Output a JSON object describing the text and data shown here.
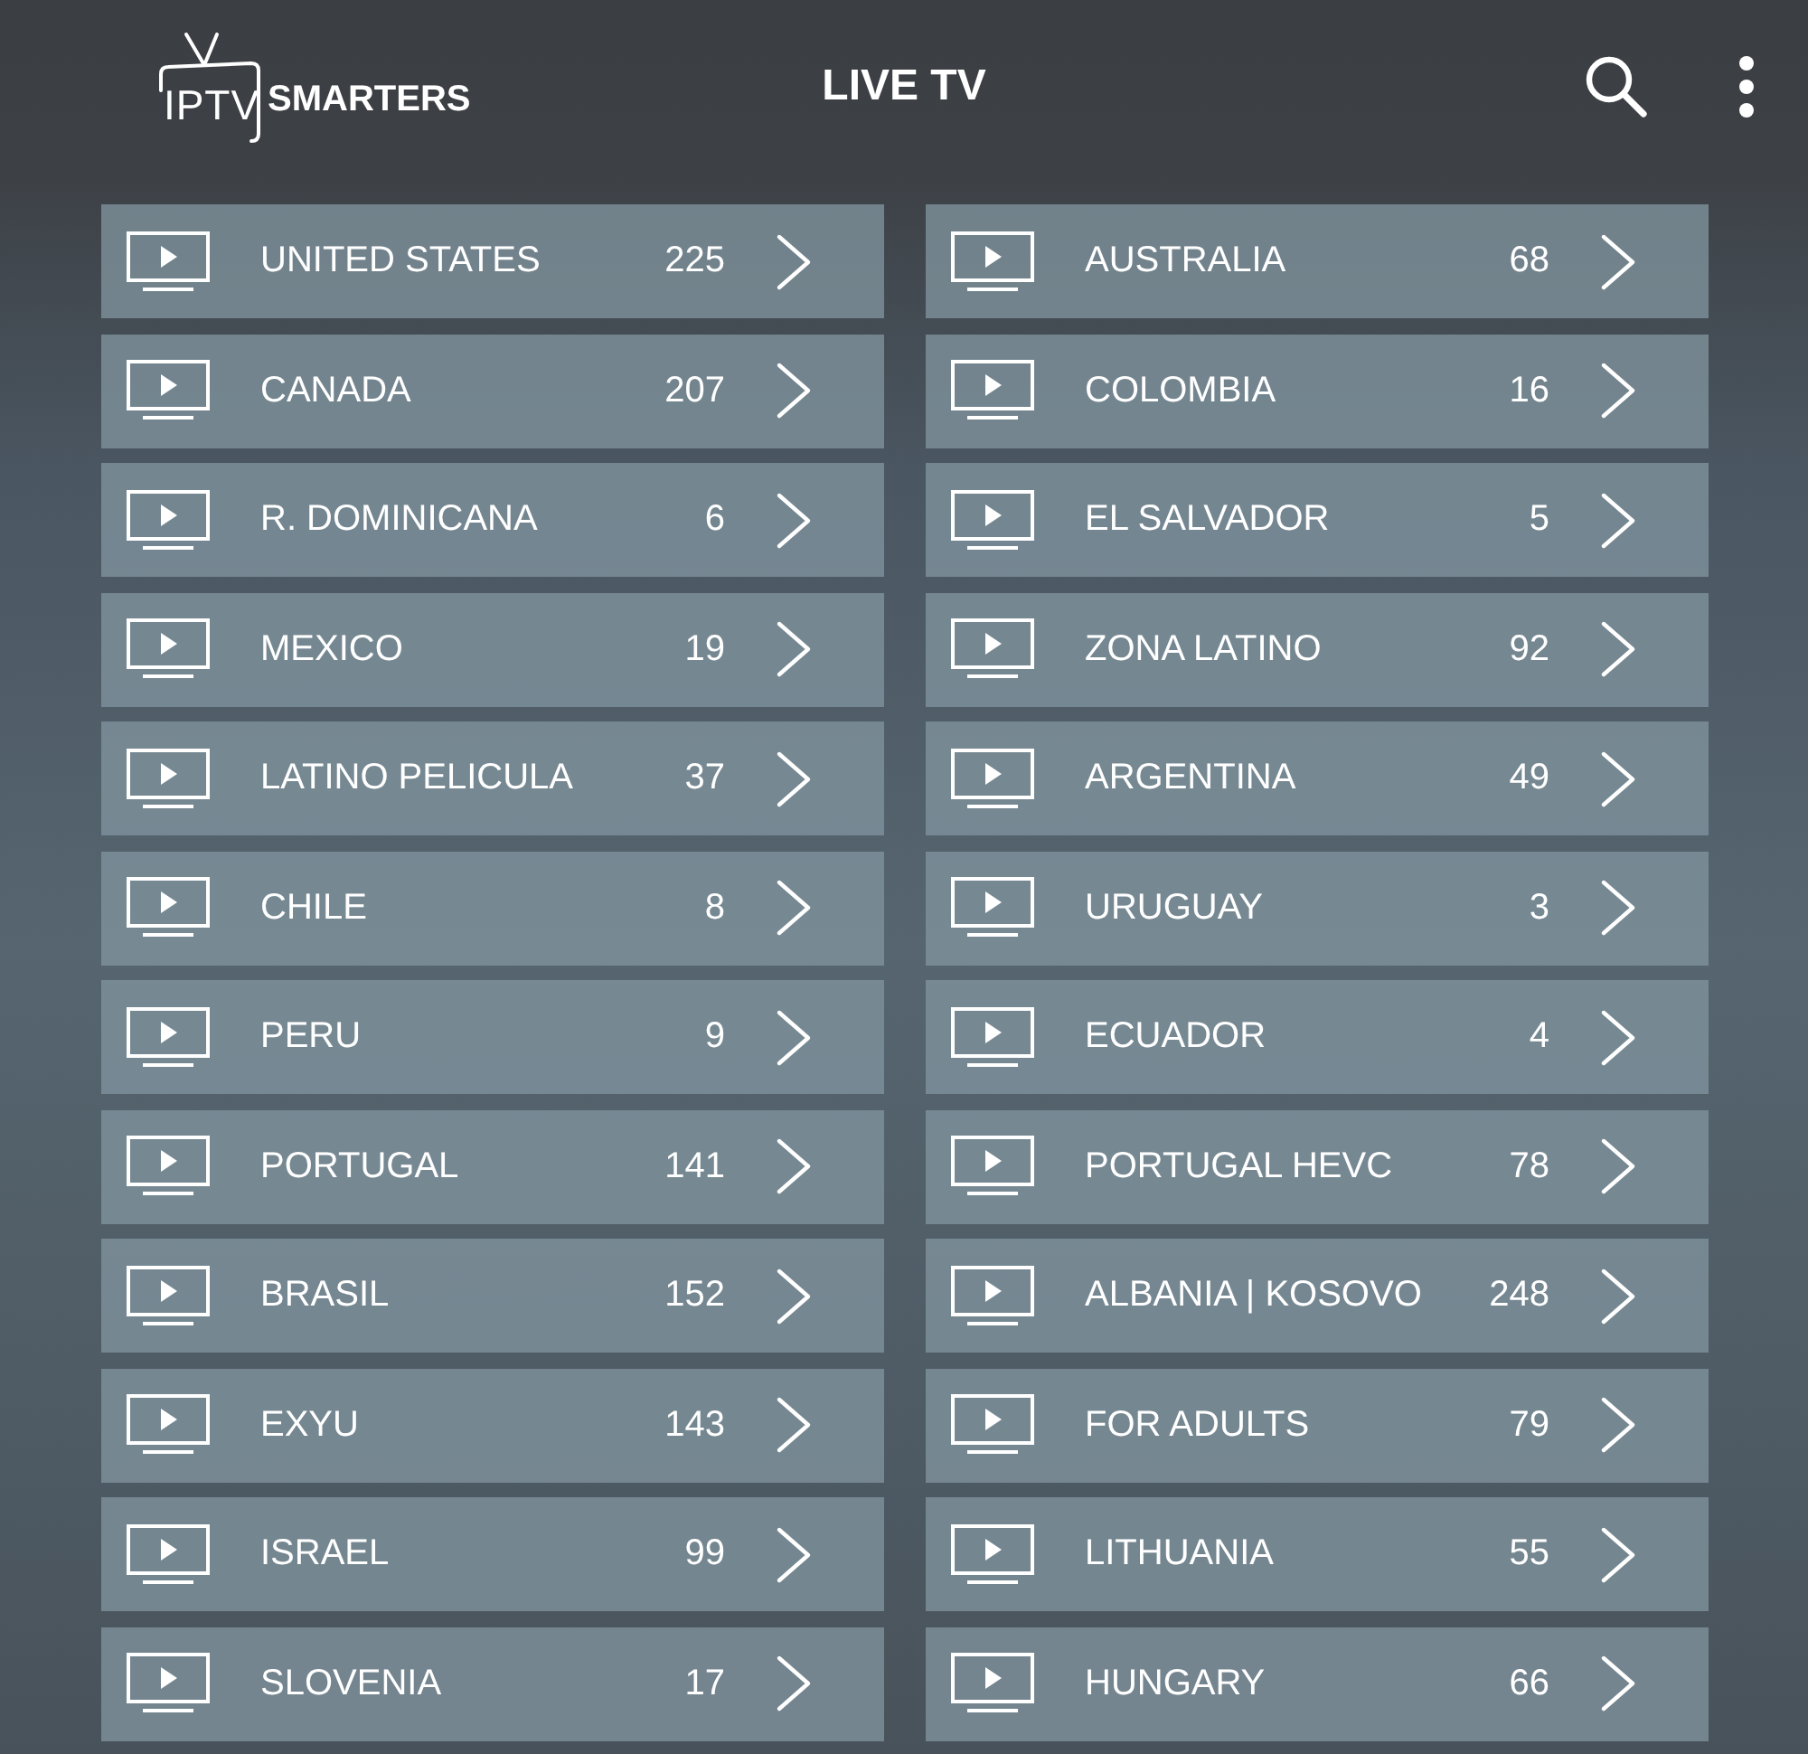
{
  "header": {
    "logo": {
      "thin_text": "IPTV",
      "bold_text": "SMARTERS"
    },
    "title": "LIVE TV"
  },
  "categories": [
    {
      "name": "UNITED STATES",
      "count": "225"
    },
    {
      "name": "AUSTRALIA",
      "count": "68"
    },
    {
      "name": "CANADA",
      "count": "207"
    },
    {
      "name": "COLOMBIA",
      "count": "16"
    },
    {
      "name": "R. DOMINICANA",
      "count": "6"
    },
    {
      "name": "EL SALVADOR",
      "count": "5"
    },
    {
      "name": "MEXICO",
      "count": "19"
    },
    {
      "name": "ZONA LATINO",
      "count": "92"
    },
    {
      "name": "LATINO PELICULA",
      "count": "37"
    },
    {
      "name": "ARGENTINA",
      "count": "49"
    },
    {
      "name": "CHILE",
      "count": "8"
    },
    {
      "name": "URUGUAY",
      "count": "3"
    },
    {
      "name": "PERU",
      "count": "9"
    },
    {
      "name": "ECUADOR",
      "count": "4"
    },
    {
      "name": "PORTUGAL",
      "count": "141"
    },
    {
      "name": "PORTUGAL HEVC",
      "count": "78"
    },
    {
      "name": "BRASIL",
      "count": "152"
    },
    {
      "name": "ALBANIA | KOSOVO",
      "count": "248"
    },
    {
      "name": "EXYU",
      "count": "143"
    },
    {
      "name": "FOR ADULTS",
      "count": "79"
    },
    {
      "name": "ISRAEL",
      "count": "99"
    },
    {
      "name": "LITHUANIA",
      "count": "55"
    },
    {
      "name": "SLOVENIA",
      "count": "17"
    },
    {
      "name": "HUNGARY",
      "count": "66"
    }
  ]
}
